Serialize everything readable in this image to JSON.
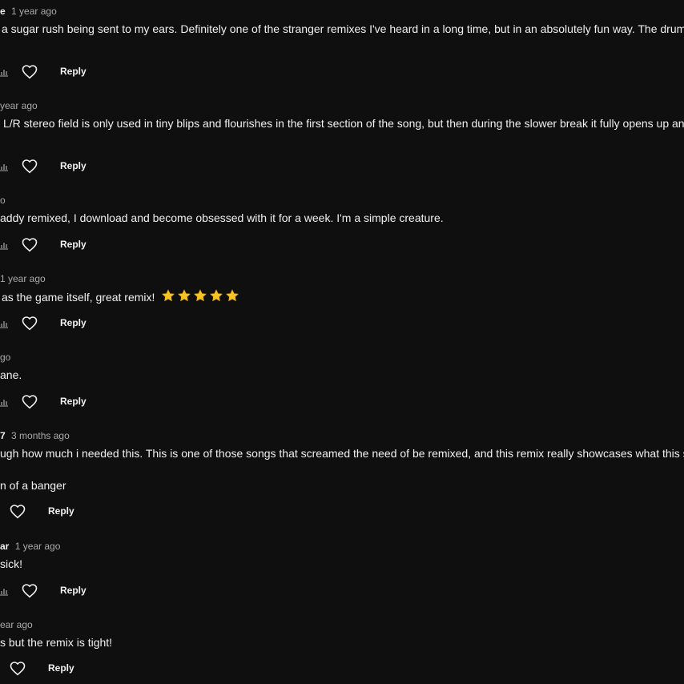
{
  "comments": [
    {
      "author": "e",
      "time": "1 year ago",
      "text": "a sugar rush being sent to my ears.  Definitely one of the stranger remixes I've heard in a long time, but in an absolutely fun way.  The drum",
      "reply_label": "Reply"
    },
    {
      "author": "",
      "time": "year ago",
      "text": "L/R stereo field is only used in tiny blips and flourishes in the first section of the song, but then during the slower break it fully opens up and",
      "reply_label": "Reply"
    },
    {
      "author": "",
      "time": "o",
      "text": "addy remixed, I download and become obsessed with it for a week. I'm a simple creature.",
      "reply_label": "Reply"
    },
    {
      "author": "",
      "time": "1 year ago",
      "text": "as the game itself, great remix!",
      "stars": 5,
      "reply_label": "Reply"
    },
    {
      "author": "",
      "time": "go",
      "text": "ane.",
      "reply_label": "Reply"
    },
    {
      "author": "7",
      "time": "3 months ago",
      "text": "ugh how much i needed this. This is one of those songs that screamed the need of be remixed, and this remix really showcases what this s",
      "text_line2": "n of a banger",
      "reply_label": "Reply"
    },
    {
      "author": "ar",
      "time": "1 year ago",
      "text": "sick!",
      "reply_label": "Reply"
    },
    {
      "author": "",
      "time": "ear ago",
      "text": "s but the remix is tight!",
      "reply_label": "Reply"
    }
  ],
  "icons": {
    "stats": "stats-icon",
    "like": "heart-icon",
    "rating": "star-icon"
  },
  "colors": {
    "background": "#0f0f0f",
    "text": "#f1f1f1",
    "secondary_text": "#aaaaaa",
    "star": "#f7c325"
  }
}
